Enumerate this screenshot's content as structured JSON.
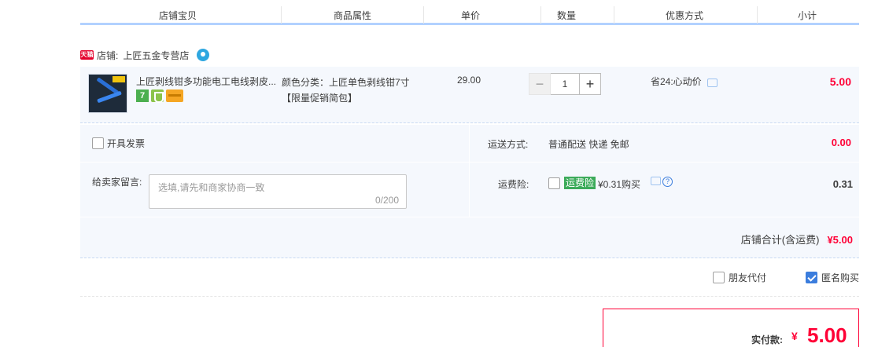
{
  "header": {
    "columns": [
      "店铺宝贝",
      "商品属性",
      "单价",
      "数量",
      "优惠方式",
      "小计"
    ]
  },
  "shop": {
    "badge": "天猫",
    "label": "店铺:",
    "name": "上匠五金专营店"
  },
  "item": {
    "title": "上匠剥线钳多功能电工电线剥皮...",
    "attr_line1": "颜色分类：上匠单色剥线钳7寸",
    "attr_line2": "【限量促销简包】",
    "icon_7": "7",
    "price": "29.00",
    "qty_minus": "−",
    "quantity": "1",
    "qty_plus": "+",
    "discount": "省24:心动价",
    "subtotal": "5.00"
  },
  "options": {
    "invoice_label": "开具发票",
    "shipping_label": "运送方式:",
    "shipping_value": "普通配送 快递 免邮",
    "shipping_price": "0.00",
    "message_label": "给卖家留言:",
    "message_placeholder": "选填,请先和商家协商一致",
    "message_count": "0/200",
    "insurance_label": "运费险:",
    "insurance_badge": "运费险",
    "insurance_price": "¥0.31购买",
    "insurance_help": "?",
    "insurance_amount": "0.31",
    "shop_total_label": "店铺合计(含运费)",
    "shop_total_value": "¥5.00"
  },
  "extras": {
    "friend_pay_label": "朋友代付",
    "anonymous_label": "匿名购买",
    "anonymous_checked": true
  },
  "payment": {
    "label": "实付款:",
    "currency": "¥",
    "value": "5.00"
  },
  "colors": {
    "accent": "#ff0036",
    "header_border": "#b2d1ff",
    "row_bg": "#f5f8fd",
    "checkbox_checked": "#3b7ddd",
    "insurance_badge": "#3cab5a"
  },
  "icons": [
    "tmall-badge",
    "wangwang-icon",
    "seven-day-return-icon",
    "shield-icon",
    "card-icon",
    "chat-icon",
    "help-icon",
    "checkbox-icon"
  ]
}
